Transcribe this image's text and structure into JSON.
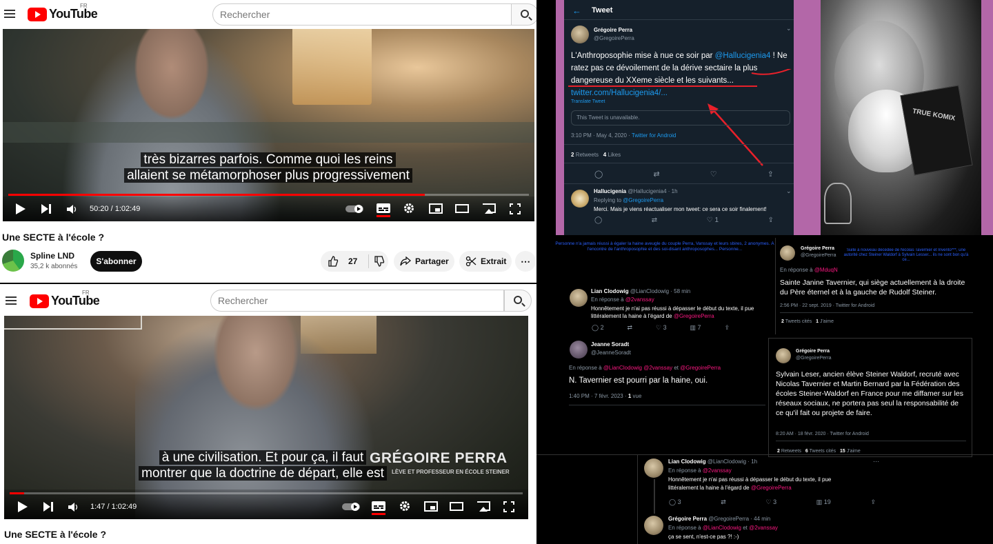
{
  "yt_top": {
    "search_placeholder": "Rechercher",
    "logo_text": "YouTube",
    "region": "FR",
    "subtitle_line1": "très bizarres parfois. Comme quoi les reins",
    "subtitle_line2": "allaient se métamorphoser plus progressivement",
    "time": "50:20 / 1:02:49",
    "progress": 0.8,
    "title": "Une SECTE à l'école ?",
    "channel": "Spline LND",
    "subscribers": "35,2 k abonnés",
    "subscribe_label": "S'abonner",
    "likes": "27",
    "share_label": "Partager",
    "clip_label": "Extrait"
  },
  "yt_bottom": {
    "search_placeholder": "Rechercher",
    "logo_text": "YouTube",
    "region": "FR",
    "subtitle_line1": "à une civilisation. Et pour ça, il faut",
    "subtitle_line2": "montrer que la doctrine de départ, elle est",
    "lower_third_name": "GRÉGOIRE PERRA",
    "lower_third_sub": "LÈVE ET PROFESSEUR EN ÉCOLE STEINER",
    "time": "1:47 / 1:02:49",
    "progress": 0.028,
    "title": "Une SECTE à l'école ?"
  },
  "tweet_main": {
    "header": "Tweet",
    "name": "Grégoire Perra",
    "handle": "@GregoirePerra",
    "text_before": "L'Anthroposophie mise à nue ce soir par ",
    "mention": "@Hallucigenia4",
    "text_after": " ! Ne ratez pas ce dévoilement de la dérive sectaire la plus dangereuse du XXeme siècle et les suivants...",
    "url": "twitter.com/Hallucigenia4/...",
    "translate": "Translate Tweet",
    "unavailable": "This Tweet is unavailable.",
    "date": "3:10 PM · May 4, 2020 · ",
    "client": "Twitter for Android",
    "retweets": "2",
    "retweets_label": "Retweets",
    "likes": "4",
    "likes_label": "Likes",
    "reply_name": "Hallucigenia",
    "reply_handle": "@Hallucigenia4 · 1h",
    "replying_to": "Replying to ",
    "replying_handle": "@GregoirePerra",
    "reply_text": "Merci. Mais je viens réactualiser mon tweet: ce sera ce soir finalement!",
    "reply_like_count": "1"
  },
  "photo": {
    "book_text": "TRUE KOMIX"
  },
  "collage": {
    "blue_note": "Personne n'a jamais réussi à égaler la haine aveugle du couple Perra, Vanssay et leurs sbires, 2 anonymes. À l'encontre de l'anthroposophie et des soi-disant anthroposophes... Personne...",
    "lian1_name": "Lian Clodowig",
    "lian1_handle": "@LianClodowig · 58 min",
    "lian1_reply_to": "En réponse à ",
    "lian1_reply_handle": "@2vanssay",
    "lian1_text": "Honnêtement je n'ai pas réussi à dépasser le début du texte, il pue littéralement la haine à l'égard de ",
    "lian1_mention": "@GregoirePerra",
    "lian1_replies": "2",
    "lian1_likes": "3",
    "lian1_views": "7",
    "jeanne_name": "Jeanne Soradt",
    "jeanne_handle": "@JeanneSoradt",
    "jeanne_reply_to": "En réponse à ",
    "jeanne_reply_h1": "@LianClodowig",
    "jeanne_reply_h2": "@2vanssay",
    "jeanne_reply_h3": "@GregoirePerra",
    "jeanne_and": "et",
    "jeanne_text": "N. Tavernier est pourri par la haine, oui.",
    "jeanne_date": "1:40 PM · 7 févr. 2023 · ",
    "jeanne_views": "1",
    "jeanne_views_label": "vue",
    "gp2_name": "Grégoire Perra",
    "gp2_handle": "@GregoirePerra",
    "gp2_reply_to": "En réponse à ",
    "gp2_reply_handle": "@MduqN",
    "gp2_blue_note": "Suite à nouveau décédée de Nicolas Tavernier et Invento***, une autorité chez Steiner Waldorf à Sylvain Lesser... ils ne sont bon qu'à ce... ",
    "gp2_text": "Sainte Janine Tavernier, qui siège actuellement à la droite du Père éternel et à la gauche de Rudolf Steiner.",
    "gp2_date": "2:56 PM · 22 sept. 2019 · Twitter for Android",
    "gp2_cites": "2",
    "gp2_cites_label": "Tweets cités",
    "gp2_likes": "1",
    "gp2_likes_label": "J'aime",
    "gp3_name": "Grégoire Perra",
    "gp3_handle": "@GregoirePerra",
    "gp3_text": "Sylvain Leser, ancien élève Steiner Waldorf, recruté avec Nicolas Tavernier et Martin Bernard par la Fédération des écoles Steiner-Waldorf en France pour me diffamer sur les réseaux sociaux, ne portera pas seul la responsabilité de ce qu'il fait ou projete de faire.",
    "gp3_date": "8:20 AM · 18 févr. 2020 · Twitter for Android",
    "gp3_retweets": "2",
    "gp3_retweets_label": "Retweets",
    "gp3_cites": "6",
    "gp3_cites_label": "Tweets cités",
    "gp3_likes": "15",
    "gp3_likes_label": "J'aime",
    "lian2_name": "Lian Clodowig",
    "lian2_handle": "@LianClodowig · 1h",
    "lian2_reply_to": "En réponse à ",
    "lian2_reply_handle": "@2vanssay",
    "lian2_text": "Honnêtement je n'ai pas réussi à dépasser le début du texte, il pue littéralement la haine à l'égard de ",
    "lian2_mention": "@GregoirePerra",
    "lian2_replies": "3",
    "lian2_likes": "3",
    "lian2_views": "19",
    "gp4_name": "Grégoire Perra",
    "gp4_handle": "@GregoirePerra · 44 min",
    "gp4_reply_to": "En réponse à ",
    "gp4_reply_h1": "@LianClodowig",
    "gp4_and": "et",
    "gp4_reply_h2": "@2vanssay",
    "gp4_text": "ça se sent, n'est-ce pas ?! :-)"
  }
}
